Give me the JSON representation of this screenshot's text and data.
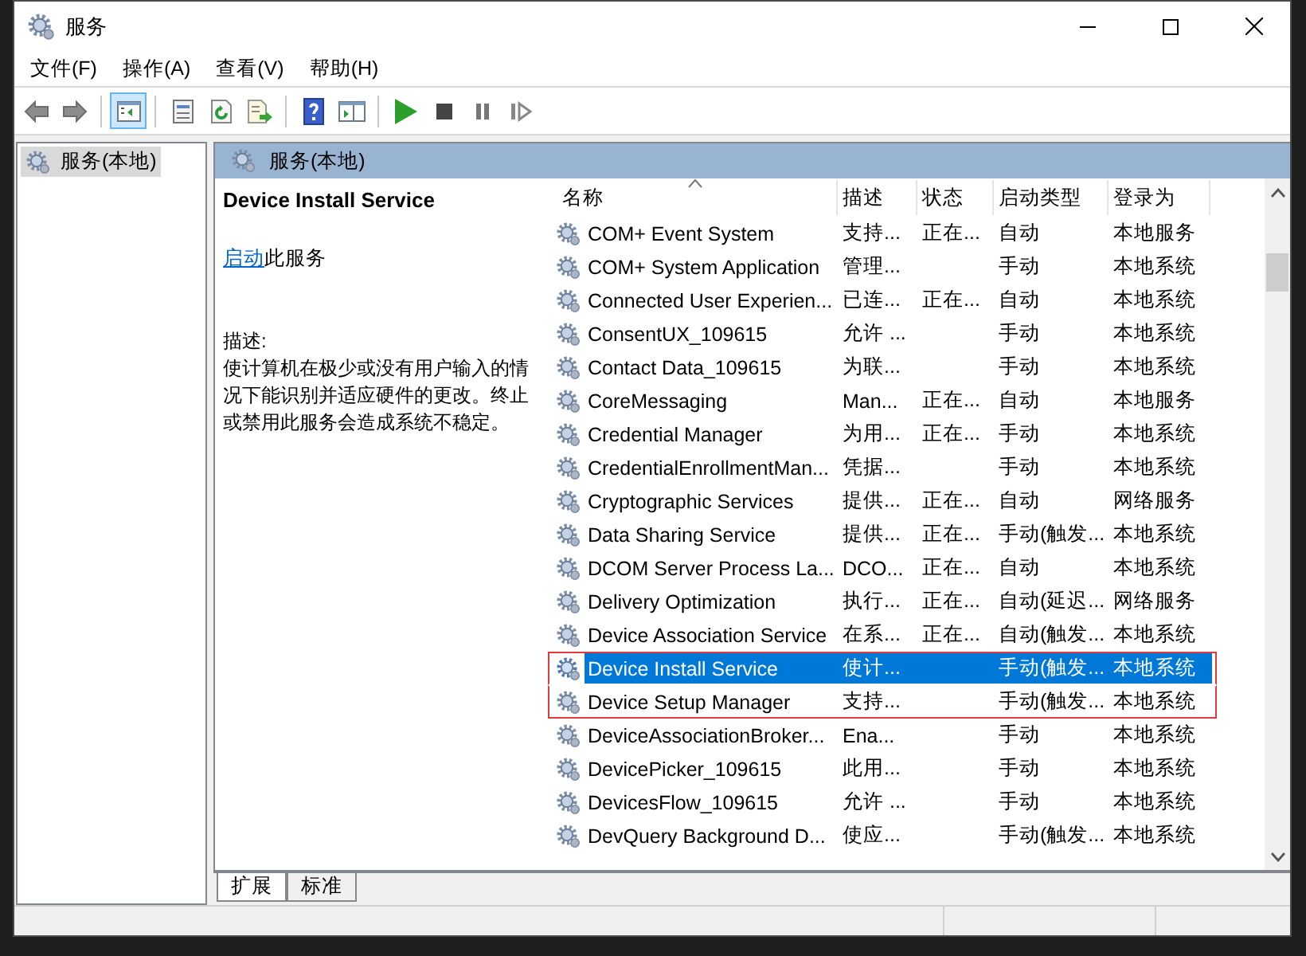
{
  "window": {
    "title": "服务"
  },
  "menu": [
    "文件(F)",
    "操作(A)",
    "查看(V)",
    "帮助(H)"
  ],
  "toolbar": [
    [
      {
        "kind": "back",
        "pressed": false
      },
      {
        "kind": "forward",
        "pressed": false
      }
    ],
    [
      {
        "kind": "tree",
        "pressed": true
      }
    ],
    [
      {
        "kind": "properties",
        "pressed": false
      },
      {
        "kind": "refresh",
        "pressed": false
      },
      {
        "kind": "export",
        "pressed": false
      }
    ],
    [
      {
        "kind": "help",
        "pressed": false
      },
      {
        "kind": "view",
        "pressed": false
      }
    ],
    [
      {
        "kind": "play",
        "pressed": false
      },
      {
        "kind": "stop",
        "pressed": false
      },
      {
        "kind": "pause",
        "pressed": false
      },
      {
        "kind": "resume",
        "pressed": false
      }
    ]
  ],
  "tree": {
    "items": [
      {
        "label": "服务(本地)",
        "selected": true
      }
    ]
  },
  "panel": {
    "title": "服务(本地)",
    "detail": {
      "service_name": "Device Install Service",
      "action_link": "启动",
      "action_text": "此服务",
      "description_label": "描述:",
      "description": "使计算机在极少或没有用户输入的情况下能识别并适应硬件的更改。终止或禁用此服务会造成系统不稳定。"
    },
    "table": {
      "columns": [
        "名称",
        "描述",
        "状态",
        "启动类型",
        "登录为"
      ],
      "rows": [
        {
          "name": "COM+ Event System",
          "description": "支持...",
          "status": "正在...",
          "startup": "自动",
          "logon": "本地服务",
          "selected": false,
          "outlined": false
        },
        {
          "name": "COM+ System Application",
          "description": "管理...",
          "status": "",
          "startup": "手动",
          "logon": "本地系统",
          "selected": false,
          "outlined": false
        },
        {
          "name": "Connected User Experien...",
          "description": "已连...",
          "status": "正在...",
          "startup": "自动",
          "logon": "本地系统",
          "selected": false,
          "outlined": false
        },
        {
          "name": "ConsentUX_109615",
          "description": "允许 ...",
          "status": "",
          "startup": "手动",
          "logon": "本地系统",
          "selected": false,
          "outlined": false
        },
        {
          "name": "Contact Data_109615",
          "description": "为联...",
          "status": "",
          "startup": "手动",
          "logon": "本地系统",
          "selected": false,
          "outlined": false
        },
        {
          "name": "CoreMessaging",
          "description": "Man...",
          "status": "正在...",
          "startup": "自动",
          "logon": "本地服务",
          "selected": false,
          "outlined": false
        },
        {
          "name": "Credential Manager",
          "description": "为用...",
          "status": "正在...",
          "startup": "手动",
          "logon": "本地系统",
          "selected": false,
          "outlined": false
        },
        {
          "name": "CredentialEnrollmentMan...",
          "description": "凭据...",
          "status": "",
          "startup": "手动",
          "logon": "本地系统",
          "selected": false,
          "outlined": false
        },
        {
          "name": "Cryptographic Services",
          "description": "提供...",
          "status": "正在...",
          "startup": "自动",
          "logon": "网络服务",
          "selected": false,
          "outlined": false
        },
        {
          "name": "Data Sharing Service",
          "description": "提供...",
          "status": "正在...",
          "startup": "手动(触发...",
          "logon": "本地系统",
          "selected": false,
          "outlined": false
        },
        {
          "name": "DCOM Server Process La...",
          "description": "DCO...",
          "status": "正在...",
          "startup": "自动",
          "logon": "本地系统",
          "selected": false,
          "outlined": false
        },
        {
          "name": "Delivery Optimization",
          "description": "执行...",
          "status": "正在...",
          "startup": "自动(延迟...",
          "logon": "网络服务",
          "selected": false,
          "outlined": false
        },
        {
          "name": "Device Association Service",
          "description": "在系...",
          "status": "正在...",
          "startup": "自动(触发...",
          "logon": "本地系统",
          "selected": false,
          "outlined": false
        },
        {
          "name": "Device Install Service",
          "description": "使计...",
          "status": "",
          "startup": "手动(触发...",
          "logon": "本地系统",
          "selected": true,
          "outlined": true
        },
        {
          "name": "Device Setup Manager",
          "description": "支持...",
          "status": "",
          "startup": "手动(触发...",
          "logon": "本地系统",
          "selected": false,
          "outlined": true
        },
        {
          "name": "DeviceAssociationBroker...",
          "description": "Ena...",
          "status": "",
          "startup": "手动",
          "logon": "本地系统",
          "selected": false,
          "outlined": false
        },
        {
          "name": "DevicePicker_109615",
          "description": "此用...",
          "status": "",
          "startup": "手动",
          "logon": "本地系统",
          "selected": false,
          "outlined": false
        },
        {
          "name": "DevicesFlow_109615",
          "description": "允许 ...",
          "status": "",
          "startup": "手动",
          "logon": "本地系统",
          "selected": false,
          "outlined": false
        },
        {
          "name": "DevQuery Background D...",
          "description": "使应...",
          "status": "",
          "startup": "手动(触发...",
          "logon": "本地系统",
          "selected": false,
          "outlined": false
        }
      ]
    }
  },
  "tabs": [
    {
      "label": "扩展",
      "selected": true
    },
    {
      "label": "标准",
      "selected": false
    }
  ]
}
